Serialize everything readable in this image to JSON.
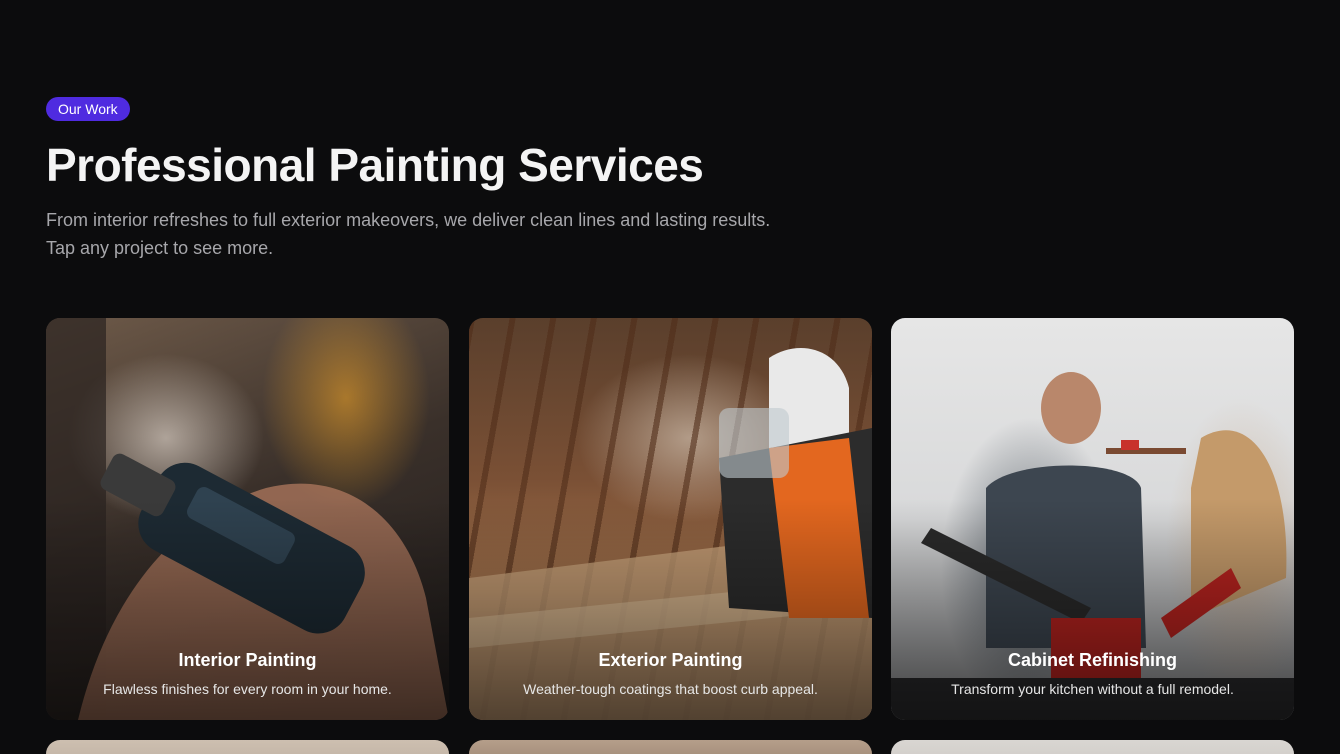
{
  "header": {
    "badge": "Our Work",
    "title": "Professional Painting Services",
    "subtitle": "From interior refreshes to full exterior makeovers, we deliver clean lines and lasting results. Tap any project to see more."
  },
  "cards": [
    {
      "title": "Interior Painting",
      "description": "Flawless finishes for every room in your home."
    },
    {
      "title": "Exterior Painting",
      "description": "Weather-tough coatings that boost curb appeal."
    },
    {
      "title": "Cabinet Refinishing",
      "description": "Transform your kitchen without a full remodel."
    }
  ],
  "colors": {
    "background": "#0c0c0d",
    "badge": "#4f2be0",
    "subtitle": "#a7a7ab"
  }
}
